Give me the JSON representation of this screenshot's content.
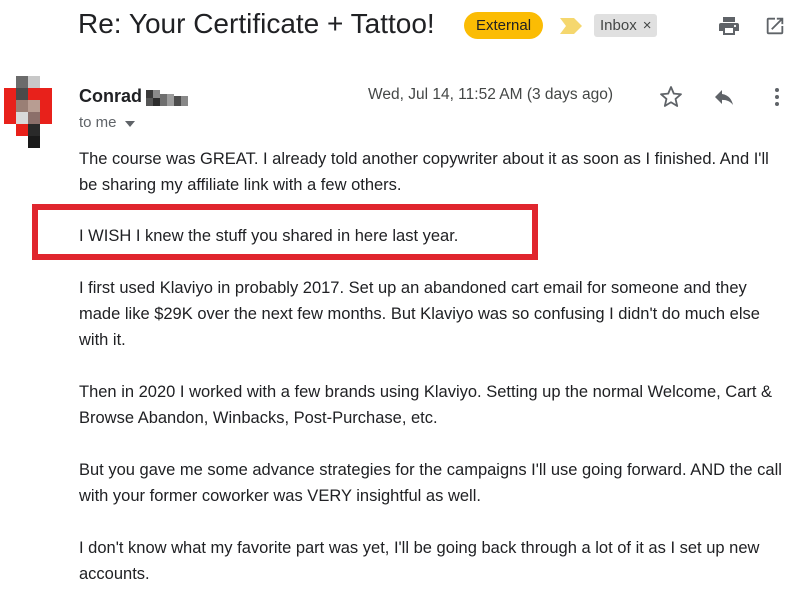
{
  "email": {
    "subject": "Re: Your Certificate + Tattoo!",
    "labels": {
      "external": "External",
      "inbox": "Inbox",
      "inbox_remove": "×"
    },
    "sender": {
      "name": "Conrad",
      "recipient_line": "to me"
    },
    "date": "Wed, Jul 14, 11:52 AM (3 days ago)",
    "body": [
      "The course was GREAT. I already told another copywriter about it as soon as I finished. And I'll be sharing my affiliate link with a few others.",
      "I WISH I knew the stuff you shared in here last year.",
      "I first used Klaviyo in probably 2017. Set up an abandoned cart email for someone and they made like $29K over the next few months. But Klaviyo was so confusing I didn't do much else with it.",
      "Then in 2020 I worked with a few brands using Klaviyo. Setting up the normal Welcome, Cart & Browse Abandon, Winbacks, Post-Purchase, etc.",
      "But you gave me some advance strategies for the campaigns I'll use going forward. AND the call with your former coworker was VERY insightful as well.",
      "I don't know what my favorite part was yet, I'll be going back through a lot of it as I set up new accounts."
    ]
  },
  "icons": {
    "print": "printer-icon",
    "open_new": "open-in-new-window-icon",
    "star": "star-icon",
    "reply": "reply-icon",
    "more": "more-vertical-icon",
    "importance": "importance-marker-icon"
  },
  "colors": {
    "external_label": "#fbbc04",
    "importance_marker": "#f5d76e",
    "inbox_label": "#e0e0e0",
    "highlight_border": "#e0262e"
  }
}
